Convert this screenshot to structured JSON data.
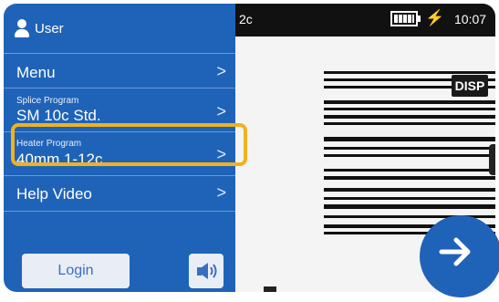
{
  "user": {
    "label": "User"
  },
  "menu": {
    "items": [
      {
        "label": "Menu",
        "chevron": ">"
      },
      {
        "sub_label": "Splice Program",
        "label": "SM 10c Std.",
        "chevron": ">"
      },
      {
        "sub_label": "Heater Program",
        "label": "40mm 1-12c",
        "chevron": ">"
      },
      {
        "label": "Help Video",
        "chevron": ">"
      }
    ]
  },
  "footer": {
    "login_label": "Login"
  },
  "status": {
    "program_tag": "2c",
    "time": "10:07",
    "charge_symbol": "⚡"
  },
  "view": {
    "disp_label": "DISP"
  },
  "icons": {
    "user": "user-icon",
    "sound": "speaker-icon",
    "next": "arrow-right-icon",
    "battery": "battery-full-icon"
  },
  "colors": {
    "panel": "#1f63b8",
    "highlight": "#f2b11d",
    "status_bar": "#111111"
  }
}
